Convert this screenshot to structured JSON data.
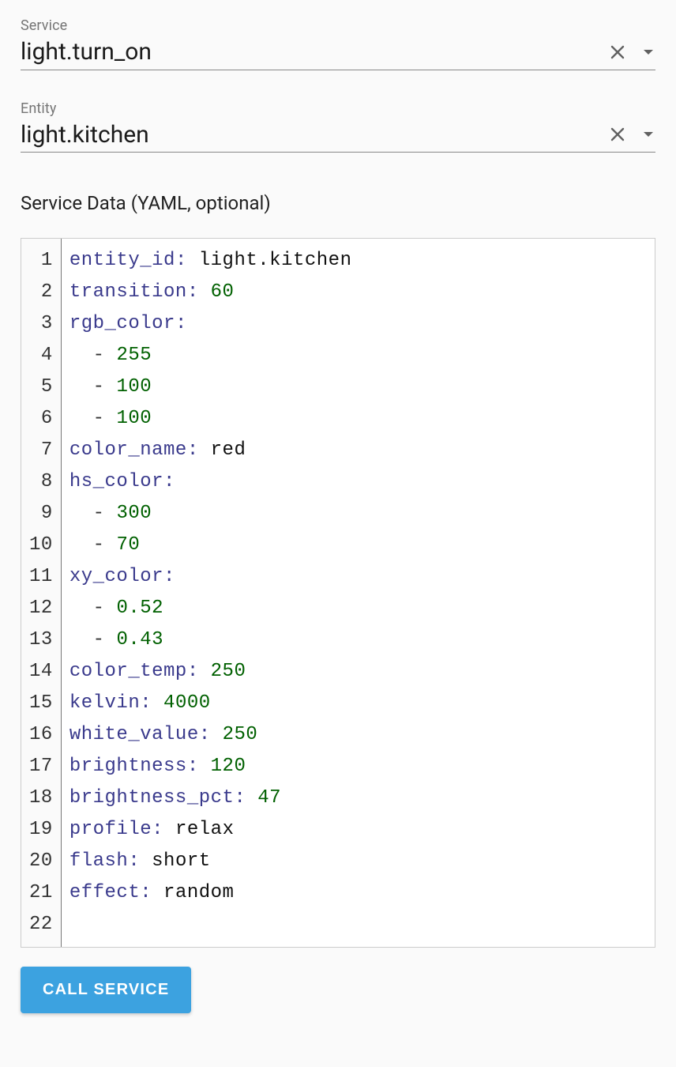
{
  "fields": {
    "service": {
      "label": "Service",
      "value": "light.turn_on"
    },
    "entity": {
      "label": "Entity",
      "value": "light.kitchen"
    },
    "data": {
      "label": "Service Data (YAML, optional)"
    }
  },
  "buttons": {
    "call_service": "CALL SERVICE"
  },
  "yaml_lines": [
    {
      "n": 1,
      "tokens": [
        {
          "t": "key",
          "v": "entity_id"
        },
        {
          "t": "punc",
          "v": ":"
        },
        {
          "t": "sp",
          "v": " "
        },
        {
          "t": "str",
          "v": "light.kitchen"
        }
      ]
    },
    {
      "n": 2,
      "tokens": [
        {
          "t": "key",
          "v": "transition"
        },
        {
          "t": "punc",
          "v": ":"
        },
        {
          "t": "sp",
          "v": " "
        },
        {
          "t": "num",
          "v": "60"
        }
      ]
    },
    {
      "n": 3,
      "tokens": [
        {
          "t": "key",
          "v": "rgb_color"
        },
        {
          "t": "punc",
          "v": ":"
        }
      ]
    },
    {
      "n": 4,
      "tokens": [
        {
          "t": "sp",
          "v": "  "
        },
        {
          "t": "dash",
          "v": "-"
        },
        {
          "t": "sp",
          "v": " "
        },
        {
          "t": "num",
          "v": "255"
        }
      ]
    },
    {
      "n": 5,
      "tokens": [
        {
          "t": "sp",
          "v": "  "
        },
        {
          "t": "dash",
          "v": "-"
        },
        {
          "t": "sp",
          "v": " "
        },
        {
          "t": "num",
          "v": "100"
        }
      ]
    },
    {
      "n": 6,
      "tokens": [
        {
          "t": "sp",
          "v": "  "
        },
        {
          "t": "dash",
          "v": "-"
        },
        {
          "t": "sp",
          "v": " "
        },
        {
          "t": "num",
          "v": "100"
        }
      ]
    },
    {
      "n": 7,
      "tokens": [
        {
          "t": "key",
          "v": "color_name"
        },
        {
          "t": "punc",
          "v": ":"
        },
        {
          "t": "sp",
          "v": " "
        },
        {
          "t": "str",
          "v": "red"
        }
      ]
    },
    {
      "n": 8,
      "tokens": [
        {
          "t": "key",
          "v": "hs_color"
        },
        {
          "t": "punc",
          "v": ":"
        }
      ]
    },
    {
      "n": 9,
      "tokens": [
        {
          "t": "sp",
          "v": "  "
        },
        {
          "t": "dash",
          "v": "-"
        },
        {
          "t": "sp",
          "v": " "
        },
        {
          "t": "num",
          "v": "300"
        }
      ]
    },
    {
      "n": 10,
      "tokens": [
        {
          "t": "sp",
          "v": "  "
        },
        {
          "t": "dash",
          "v": "-"
        },
        {
          "t": "sp",
          "v": " "
        },
        {
          "t": "num",
          "v": "70"
        }
      ]
    },
    {
      "n": 11,
      "tokens": [
        {
          "t": "key",
          "v": "xy_color"
        },
        {
          "t": "punc",
          "v": ":"
        }
      ]
    },
    {
      "n": 12,
      "tokens": [
        {
          "t": "sp",
          "v": "  "
        },
        {
          "t": "dash",
          "v": "-"
        },
        {
          "t": "sp",
          "v": " "
        },
        {
          "t": "num",
          "v": "0.52"
        }
      ]
    },
    {
      "n": 13,
      "tokens": [
        {
          "t": "sp",
          "v": "  "
        },
        {
          "t": "dash",
          "v": "-"
        },
        {
          "t": "sp",
          "v": " "
        },
        {
          "t": "num",
          "v": "0.43"
        }
      ]
    },
    {
      "n": 14,
      "tokens": [
        {
          "t": "key",
          "v": "color_temp"
        },
        {
          "t": "punc",
          "v": ":"
        },
        {
          "t": "sp",
          "v": " "
        },
        {
          "t": "num",
          "v": "250"
        }
      ]
    },
    {
      "n": 15,
      "tokens": [
        {
          "t": "key",
          "v": "kelvin"
        },
        {
          "t": "punc",
          "v": ":"
        },
        {
          "t": "sp",
          "v": " "
        },
        {
          "t": "num",
          "v": "4000"
        }
      ]
    },
    {
      "n": 16,
      "tokens": [
        {
          "t": "key",
          "v": "white_value"
        },
        {
          "t": "punc",
          "v": ":"
        },
        {
          "t": "sp",
          "v": " "
        },
        {
          "t": "num",
          "v": "250"
        }
      ]
    },
    {
      "n": 17,
      "tokens": [
        {
          "t": "key",
          "v": "brightness"
        },
        {
          "t": "punc",
          "v": ":"
        },
        {
          "t": "sp",
          "v": " "
        },
        {
          "t": "num",
          "v": "120"
        }
      ]
    },
    {
      "n": 18,
      "tokens": [
        {
          "t": "key",
          "v": "brightness_pct"
        },
        {
          "t": "punc",
          "v": ":"
        },
        {
          "t": "sp",
          "v": " "
        },
        {
          "t": "num",
          "v": "47"
        }
      ]
    },
    {
      "n": 19,
      "tokens": [
        {
          "t": "key",
          "v": "profile"
        },
        {
          "t": "punc",
          "v": ":"
        },
        {
          "t": "sp",
          "v": " "
        },
        {
          "t": "str",
          "v": "relax"
        }
      ]
    },
    {
      "n": 20,
      "tokens": [
        {
          "t": "key",
          "v": "flash"
        },
        {
          "t": "punc",
          "v": ":"
        },
        {
          "t": "sp",
          "v": " "
        },
        {
          "t": "str",
          "v": "short"
        }
      ]
    },
    {
      "n": 21,
      "tokens": [
        {
          "t": "key",
          "v": "effect"
        },
        {
          "t": "punc",
          "v": ":"
        },
        {
          "t": "sp",
          "v": " "
        },
        {
          "t": "str",
          "v": "random"
        }
      ]
    },
    {
      "n": 22,
      "tokens": []
    }
  ]
}
